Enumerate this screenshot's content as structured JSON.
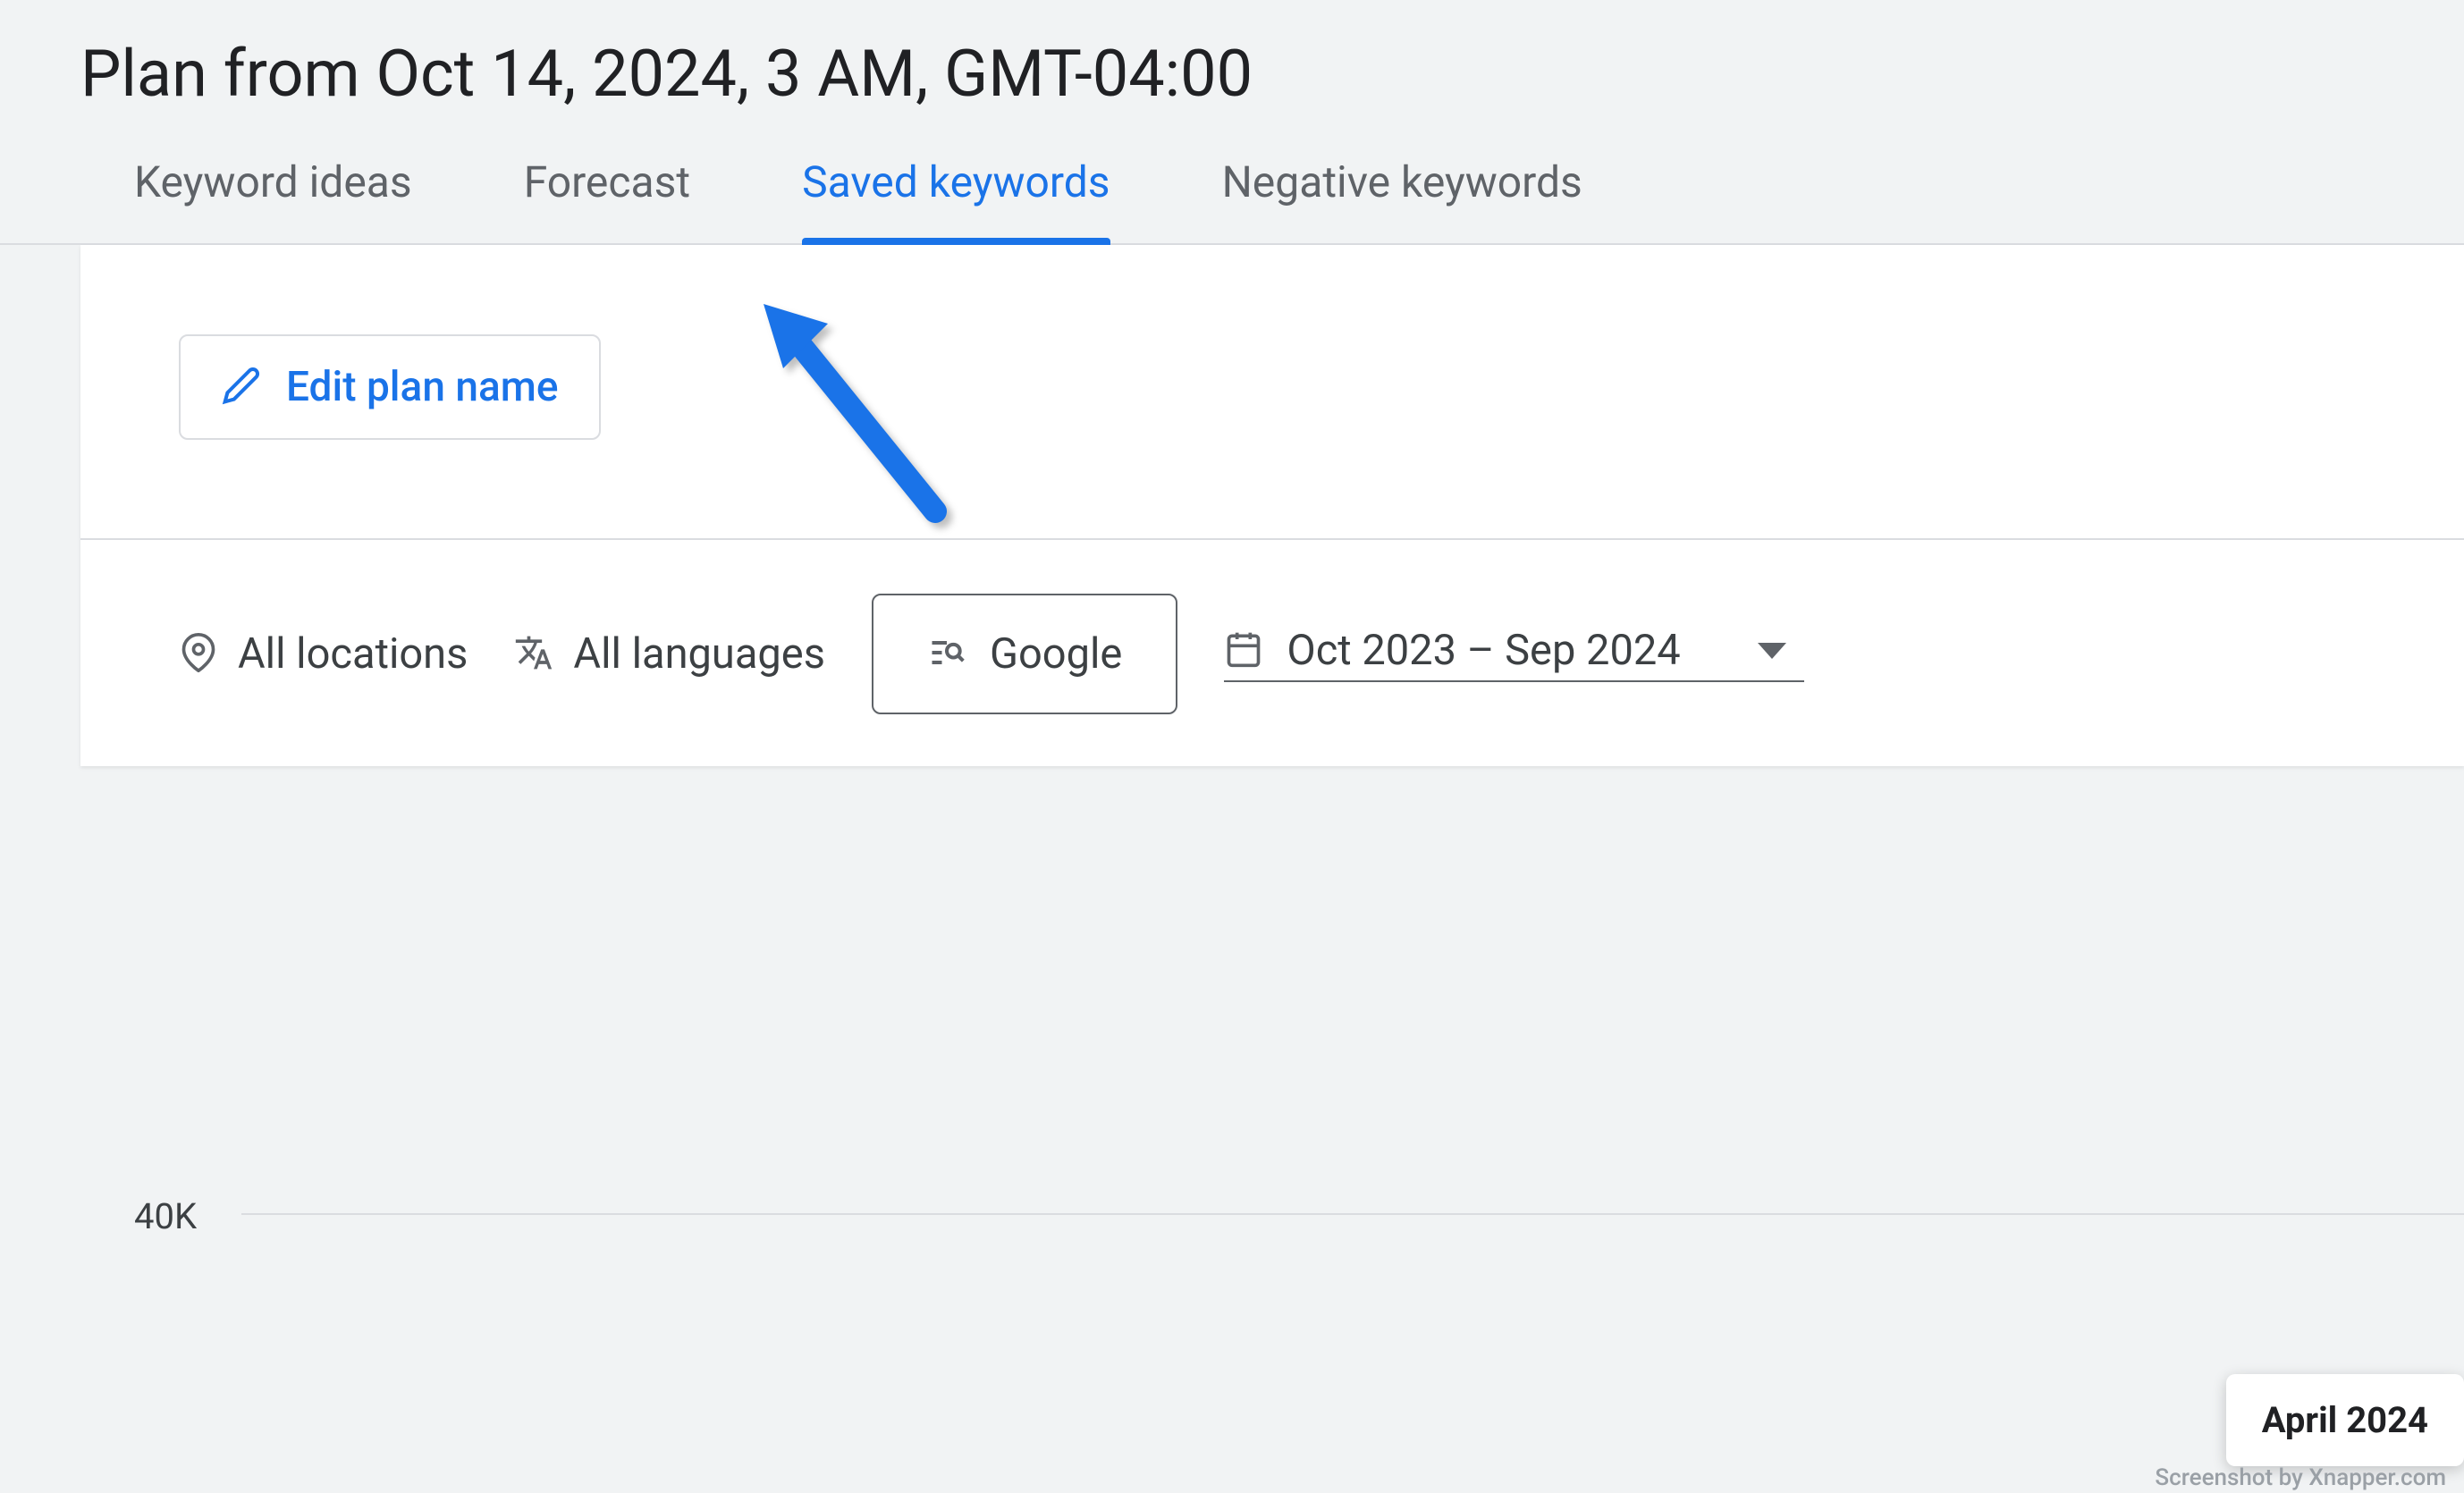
{
  "page_title": "Plan from Oct 14, 2024, 3 AM, GMT-04:00",
  "tabs": {
    "keyword_ideas": "Keyword ideas",
    "forecast": "Forecast",
    "saved_keywords": "Saved keywords",
    "negative_keywords": "Negative keywords"
  },
  "edit_button": "Edit plan name",
  "filters": {
    "locations": "All locations",
    "languages": "All languages",
    "network": "Google",
    "date_range": "Oct 2023 – Sep 2024"
  },
  "chart": {
    "y_tick": "40K",
    "tooltip_month": "April 2024"
  },
  "watermark": "Screenshot by Xnapper.com"
}
